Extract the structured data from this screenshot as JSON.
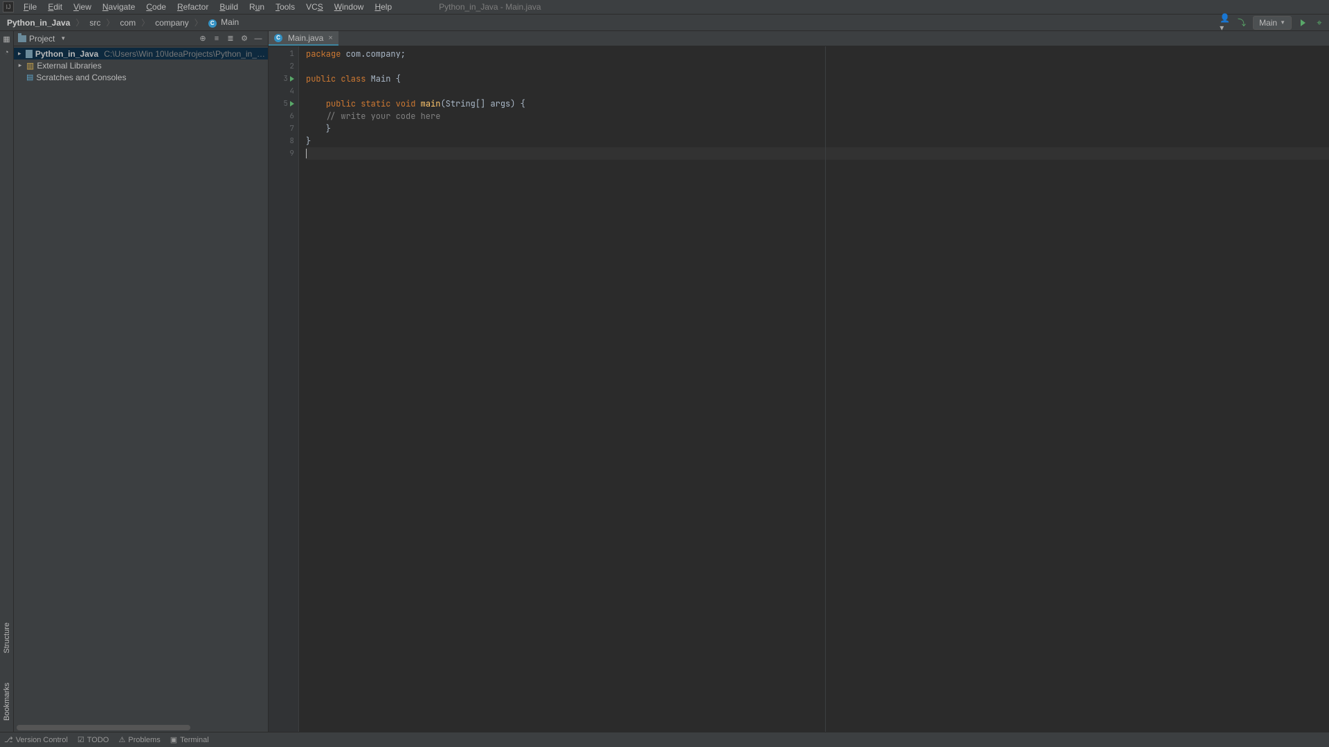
{
  "menu": {
    "file": "File",
    "edit": "Edit",
    "view": "View",
    "navigate": "Navigate",
    "code": "Code",
    "refactor": "Refactor",
    "build": "Build",
    "run": "Run",
    "tools": "Tools",
    "vcs": "VCS",
    "window": "Window",
    "help": "Help"
  },
  "window_title": "Python_in_Java - Main.java",
  "breadcrumb": {
    "project": "Python_in_Java",
    "src": "src",
    "com": "com",
    "company": "company",
    "class": "Main"
  },
  "run_config": {
    "name": "Main"
  },
  "tool": {
    "project_label": "Project",
    "structure_label": "Structure",
    "bookmarks_label": "Bookmarks"
  },
  "tree": {
    "root_name": "Python_in_Java",
    "root_path": "C:\\Users\\Win 10\\IdeaProjects\\Python_in_…",
    "libs": "External Libraries",
    "scratches": "Scratches and Consoles"
  },
  "tab": {
    "filename": "Main.java"
  },
  "gutter": {
    "l1": "1",
    "l2": "2",
    "l3": "3",
    "l4": "4",
    "l5": "5",
    "l6": "6",
    "l7": "7",
    "l8": "8",
    "l9": "9"
  },
  "code": {
    "l1_kw": "package ",
    "l1_rest": "com.company;",
    "l3_kw": "public class ",
    "l3_cls": "Main",
    "l3_rest": " {",
    "l5_pre": "    ",
    "l5_kw": "public static void ",
    "l5_fn": "main",
    "l5_rest": "(String[] args) {",
    "l6": "    // write your code here",
    "l7": "    }",
    "l8": "}"
  },
  "bottom": {
    "version_control": "Version Control",
    "todo": "TODO",
    "problems": "Problems",
    "terminal": "Terminal"
  }
}
